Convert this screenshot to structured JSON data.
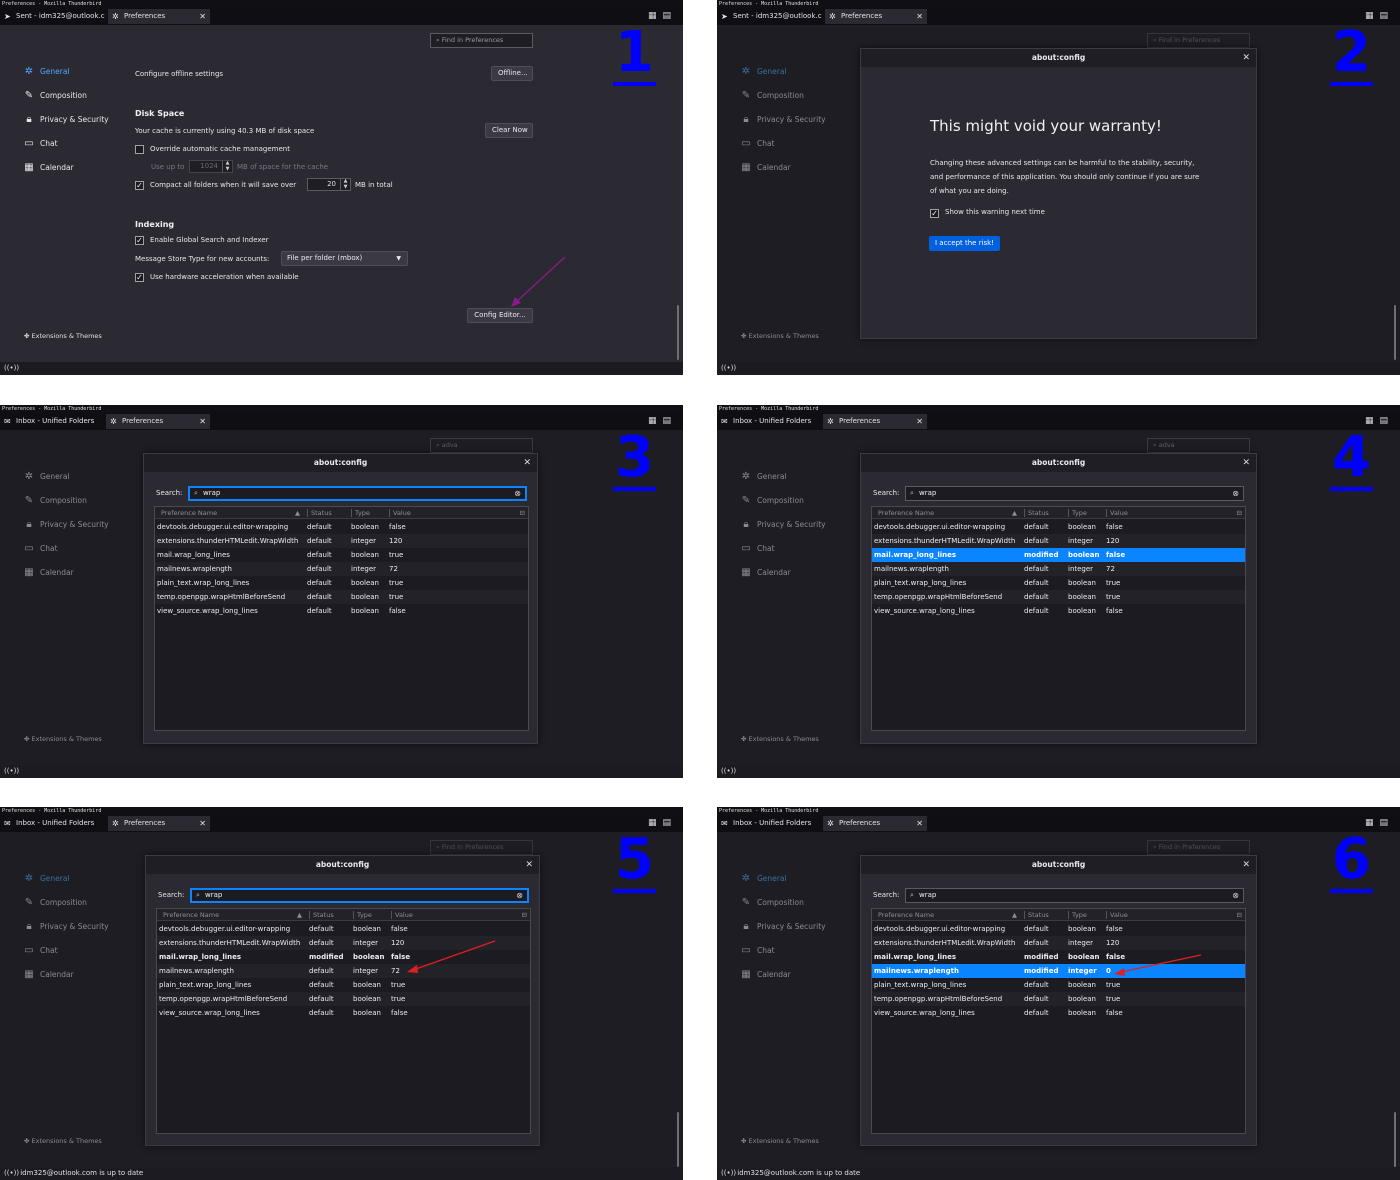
{
  "window_title": "Preferences - Mozilla Thunderbird",
  "tabs": {
    "sent": "Sent - idm325@outlook.c",
    "inbox": "Inbox - Unified Folders",
    "preferences": "Preferences"
  },
  "find_placeholder": "Find in Preferences",
  "find_value": "adva",
  "sidebar": {
    "items": [
      "General",
      "Composition",
      "Privacy & Security",
      "Chat",
      "Calendar"
    ],
    "extensions": "Extensions & Themes"
  },
  "status_message": "idm325@outlook.com is up to date",
  "steps": [
    "1",
    "2",
    "3",
    "4",
    "5",
    "6"
  ],
  "general": {
    "offline_label": "Configure offline settings",
    "offline_button": "Offline...",
    "disk_heading": "Disk Space",
    "cache_text": "Your cache is currently using 40.3 MB of disk space",
    "clear_button": "Clear Now",
    "override_label": "Override automatic cache management",
    "use_up_to": "Use up to",
    "cache_value": "1024",
    "cache_suffix": "MB of space for the cache",
    "compact_label": "Compact all folders when it will save over",
    "compact_value": "20",
    "compact_suffix": "MB in total",
    "indexing_heading": "Indexing",
    "global_search_label": "Enable Global Search and Indexer",
    "store_type_label": "Message Store Type for new accounts:",
    "store_type_value": "File per folder (mbox)",
    "hw_accel_label": "Use hardware acceleration when available",
    "config_button": "Config Editor..."
  },
  "warning": {
    "title": "about:config",
    "heading": "This might void your warranty!",
    "body_lines": [
      "Changing these advanced settings can be harmful to the stability, security,",
      "and performance of this application. You should only continue if you are sure",
      "of what you are doing."
    ],
    "show_warning": "Show this warning next time",
    "accept": "I accept the risk!"
  },
  "config": {
    "title": "about:config",
    "search_label": "Search:",
    "search_value": "wrap",
    "columns": [
      "Preference Name",
      "Status",
      "Type",
      "Value"
    ],
    "rows_initial": [
      [
        "devtools.debugger.ui.editor-wrapping",
        "default",
        "boolean",
        "false"
      ],
      [
        "extensions.thunderHTMLedit.WrapWidth",
        "default",
        "integer",
        "120"
      ],
      [
        "mail.wrap_long_lines",
        "default",
        "boolean",
        "true"
      ],
      [
        "mailnews.wraplength",
        "default",
        "integer",
        "72"
      ],
      [
        "plain_text.wrap_long_lines",
        "default",
        "boolean",
        "true"
      ],
      [
        "temp.openpgp.wrapHtmlBeforeSend",
        "default",
        "boolean",
        "true"
      ],
      [
        "view_source.wrap_long_lines",
        "default",
        "boolean",
        "false"
      ]
    ],
    "rows_modified": [
      [
        "devtools.debugger.ui.editor-wrapping",
        "default",
        "boolean",
        "false"
      ],
      [
        "extensions.thunderHTMLedit.WrapWidth",
        "default",
        "integer",
        "120"
      ],
      [
        "mail.wrap_long_lines",
        "modified",
        "boolean",
        "false"
      ],
      [
        "mailnews.wraplength",
        "default",
        "integer",
        "72"
      ],
      [
        "plain_text.wrap_long_lines",
        "default",
        "boolean",
        "true"
      ],
      [
        "temp.openpgp.wrapHtmlBeforeSend",
        "default",
        "boolean",
        "true"
      ],
      [
        "view_source.wrap_long_lines",
        "default",
        "boolean",
        "false"
      ]
    ],
    "rows_final": [
      [
        "devtools.debugger.ui.editor-wrapping",
        "default",
        "boolean",
        "false"
      ],
      [
        "extensions.thunderHTMLedit.WrapWidth",
        "default",
        "integer",
        "120"
      ],
      [
        "mail.wrap_long_lines",
        "modified",
        "boolean",
        "false"
      ],
      [
        "mailnews.wraplength",
        "modified",
        "integer",
        "0"
      ],
      [
        "plain_text.wrap_long_lines",
        "default",
        "boolean",
        "true"
      ],
      [
        "temp.openpgp.wrapHtmlBeforeSend",
        "default",
        "boolean",
        "true"
      ],
      [
        "view_source.wrap_long_lines",
        "default",
        "boolean",
        "false"
      ]
    ]
  },
  "colors": {
    "accent": "#0a84ff",
    "step_number": "#0000ff",
    "annotation_arrow_1": "#8b1a8b",
    "annotation_arrow_2": "#e0201c"
  }
}
